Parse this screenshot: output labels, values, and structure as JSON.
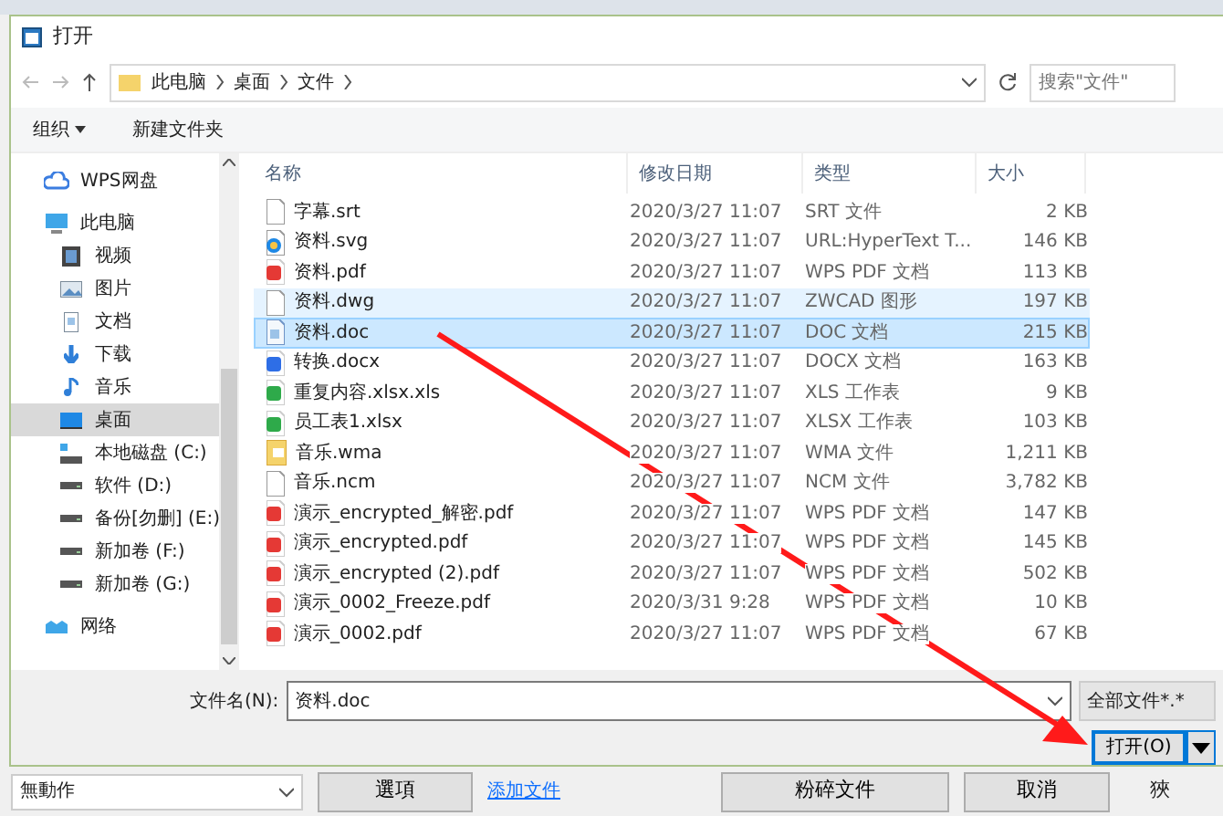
{
  "window": {
    "title": "打开"
  },
  "address": {
    "crumbs": [
      "此电脑",
      "桌面",
      "文件"
    ],
    "search_placeholder": "搜索\"文件\""
  },
  "toolbar": {
    "organize": "组织",
    "new_folder": "新建文件夹"
  },
  "nav": [
    {
      "kind": "cloud",
      "label": "WPS网盘",
      "selected": false
    },
    {
      "kind": "pc",
      "label": "此电脑",
      "selected": false,
      "children": [
        {
          "kind": "video",
          "label": "视频",
          "selected": false
        },
        {
          "kind": "picture",
          "label": "图片",
          "selected": false
        },
        {
          "kind": "document",
          "label": "文档",
          "selected": false
        },
        {
          "kind": "download",
          "label": "下载",
          "selected": false
        },
        {
          "kind": "music",
          "label": "音乐",
          "selected": false
        },
        {
          "kind": "desktop",
          "label": "桌面",
          "selected": true
        },
        {
          "kind": "sysdrive",
          "label": "本地磁盘 (C:)",
          "selected": false
        },
        {
          "kind": "drive",
          "label": "软件 (D:)",
          "selected": false
        },
        {
          "kind": "drive",
          "label": "备份[勿删] (E:)",
          "selected": false
        },
        {
          "kind": "drive",
          "label": "新加卷 (F:)",
          "selected": false
        },
        {
          "kind": "drive",
          "label": "新加卷 (G:)",
          "selected": false
        }
      ]
    },
    {
      "kind": "network",
      "label": "网络",
      "selected": false
    }
  ],
  "table": {
    "columns": [
      "名称",
      "修改日期",
      "类型",
      "大小"
    ],
    "rows": [
      {
        "kind": "blank",
        "name": "字幕.srt",
        "date": "2020/3/27 11:07",
        "type": "SRT 文件",
        "size": "2 KB",
        "selected": false,
        "hovered": false
      },
      {
        "kind": "web",
        "name": "资料.svg",
        "date": "2020/3/27 11:07",
        "type": "URL:HyperText T...",
        "size": "146 KB",
        "selected": false,
        "hovered": false
      },
      {
        "kind": "pdf",
        "name": "资料.pdf",
        "date": "2020/3/27 11:07",
        "type": "WPS PDF 文档",
        "size": "113 KB",
        "selected": false,
        "hovered": false
      },
      {
        "kind": "blank",
        "name": "资料.dwg",
        "date": "2020/3/27 11:07",
        "type": "ZWCAD 图形",
        "size": "197 KB",
        "selected": false,
        "hovered": true
      },
      {
        "kind": "doc",
        "name": "资料.doc",
        "date": "2020/3/27 11:07",
        "type": "DOC 文档",
        "size": "215 KB",
        "selected": true,
        "hovered": false
      },
      {
        "kind": "word",
        "name": "转换.docx",
        "date": "2020/3/27 11:07",
        "type": "DOCX 文档",
        "size": "163 KB",
        "selected": false,
        "hovered": false
      },
      {
        "kind": "sheet",
        "name": "重复内容.xlsx.xls",
        "date": "2020/3/27 11:07",
        "type": "XLS 工作表",
        "size": "9 KB",
        "selected": false,
        "hovered": false
      },
      {
        "kind": "sheet",
        "name": "员工表1.xlsx",
        "date": "2020/3/27 11:07",
        "type": "XLSX 工作表",
        "size": "103 KB",
        "selected": false,
        "hovered": false
      },
      {
        "kind": "audio",
        "name": "音乐.wma",
        "date": "2020/3/27 11:07",
        "type": "WMA 文件",
        "size": "1,211 KB",
        "selected": false,
        "hovered": false
      },
      {
        "kind": "blank",
        "name": "音乐.ncm",
        "date": "2020/3/27 11:07",
        "type": "NCM 文件",
        "size": "3,782 KB",
        "selected": false,
        "hovered": false
      },
      {
        "kind": "pdf",
        "name": "演示_encrypted_解密.pdf",
        "date": "2020/3/27 11:07",
        "type": "WPS PDF 文档",
        "size": "147 KB",
        "selected": false,
        "hovered": false
      },
      {
        "kind": "pdf",
        "name": "演示_encrypted.pdf",
        "date": "2020/3/27 11:07",
        "type": "WPS PDF 文档",
        "size": "145 KB",
        "selected": false,
        "hovered": false
      },
      {
        "kind": "pdf",
        "name": "演示_encrypted (2).pdf",
        "date": "2020/3/27 11:07",
        "type": "WPS PDF 文档",
        "size": "502 KB",
        "selected": false,
        "hovered": false
      },
      {
        "kind": "pdf",
        "name": "演示_0002_Freeze.pdf",
        "date": "2020/3/31 9:28",
        "type": "WPS PDF 文档",
        "size": "10 KB",
        "selected": false,
        "hovered": false
      },
      {
        "kind": "pdf",
        "name": "演示_0002.pdf",
        "date": "2020/3/27 11:07",
        "type": "WPS PDF 文档",
        "size": "67 KB",
        "selected": false,
        "hovered": false
      }
    ]
  },
  "footer": {
    "filename_label": "文件名(N):",
    "filename_value": "资料.doc",
    "filter": "全部文件*.*",
    "open_button": "打开(O)"
  },
  "background_app": {
    "action_select": "無動作",
    "options_button": "選項",
    "add_link": "添加文件",
    "shred_button": "粉碎文件",
    "cancel_button": "取消",
    "cut_text": "狹"
  }
}
